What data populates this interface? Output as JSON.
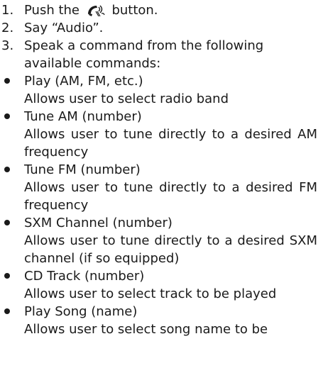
{
  "steps": [
    {
      "number": "1.",
      "prefix": "Push the ",
      "icon": "voice-talk-icon",
      "suffix": " button."
    },
    {
      "number": "2.",
      "text": "Say “Audio”."
    },
    {
      "number": "3.",
      "text": "Speak a command from the following available commands:"
    }
  ],
  "commands": [
    {
      "command": "Play (AM, FM, etc.)",
      "description": "Allows user to select radio band"
    },
    {
      "command": "Tune AM (number)",
      "description": "Allows user to tune directly to a desired AM frequency"
    },
    {
      "command": "Tune FM (number)",
      "description": "Allows user to tune directly to a desired FM frequency"
    },
    {
      "command": "SXM Channel (number)",
      "description": "Allows user to tune directly to a desired SXM channel (if so equipped)"
    },
    {
      "command": "CD Track (number)",
      "description": "Allows user to select track to be played"
    },
    {
      "command": "Play Song (name)",
      "description": "Allows user to select song name to be"
    }
  ]
}
